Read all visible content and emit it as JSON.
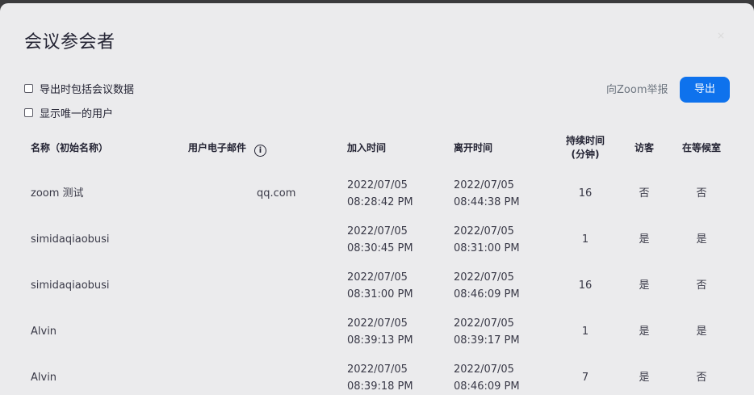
{
  "dialog": {
    "title": "会议参会者",
    "close_symbol": "×",
    "include_meeting_data_label": "导出时包括会议数据",
    "unique_users_label": "显示唯一的用户",
    "report_link": "向Zoom举报",
    "export_button": "导出"
  },
  "table": {
    "headers": {
      "name": "名称（初始名称）",
      "email": "用户电子邮件",
      "join": "加入时间",
      "leave": "离开时间",
      "duration_line1": "持续时间",
      "duration_line2": "(分钟)",
      "guest": "访客",
      "waiting": "在等候室"
    },
    "rows": [
      {
        "name": "zoom 测试",
        "email": "qq.com",
        "join_date": "2022/07/05",
        "join_time": "08:28:42 PM",
        "leave_date": "2022/07/05",
        "leave_time": "08:44:38 PM",
        "duration": "16",
        "guest": "否",
        "waiting": "否"
      },
      {
        "name": "simidaqiaobusi",
        "email": "",
        "join_date": "2022/07/05",
        "join_time": "08:30:45 PM",
        "leave_date": "2022/07/05",
        "leave_time": "08:31:00 PM",
        "duration": "1",
        "guest": "是",
        "waiting": "是"
      },
      {
        "name": "simidaqiaobusi",
        "email": "",
        "join_date": "2022/07/05",
        "join_time": "08:31:00 PM",
        "leave_date": "2022/07/05",
        "leave_time": "08:46:09 PM",
        "duration": "16",
        "guest": "是",
        "waiting": "否"
      },
      {
        "name": "Alvin",
        "email": "",
        "join_date": "2022/07/05",
        "join_time": "08:39:13 PM",
        "leave_date": "2022/07/05",
        "leave_time": "08:39:17 PM",
        "duration": "1",
        "guest": "是",
        "waiting": "是"
      },
      {
        "name": "Alvin",
        "email": "",
        "join_date": "2022/07/05",
        "join_time": "08:39:18 PM",
        "leave_date": "2022/07/05",
        "leave_time": "08:46:09 PM",
        "duration": "7",
        "guest": "是",
        "waiting": "否"
      }
    ]
  }
}
